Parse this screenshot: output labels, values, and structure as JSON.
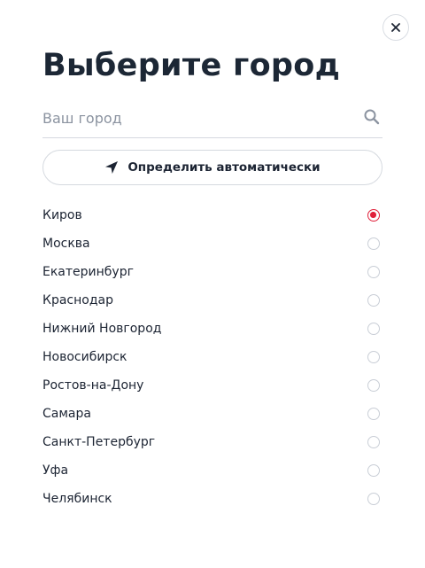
{
  "dialog": {
    "title": "Выберите город",
    "close_icon": "close-icon"
  },
  "search": {
    "placeholder": "Ваш город",
    "value": "",
    "icon": "search-icon"
  },
  "auto_detect": {
    "label": "Определить автоматически",
    "icon": "navigation-arrow-icon"
  },
  "cities": [
    {
      "label": "Киров",
      "selected": true
    },
    {
      "label": "Москва",
      "selected": false
    },
    {
      "label": "Екатеринбург",
      "selected": false
    },
    {
      "label": "Краснодар",
      "selected": false
    },
    {
      "label": "Нижний Новгород",
      "selected": false
    },
    {
      "label": "Новосибирск",
      "selected": false
    },
    {
      "label": "Ростов-на-Дону",
      "selected": false
    },
    {
      "label": "Самара",
      "selected": false
    },
    {
      "label": "Санкт-Петербург",
      "selected": false
    },
    {
      "label": "Уфа",
      "selected": false
    },
    {
      "label": "Челябинск",
      "selected": false
    }
  ],
  "colors": {
    "accent": "#e0203a",
    "text": "#1c2433",
    "muted": "#8b93a0",
    "border": "#d5d9df"
  }
}
